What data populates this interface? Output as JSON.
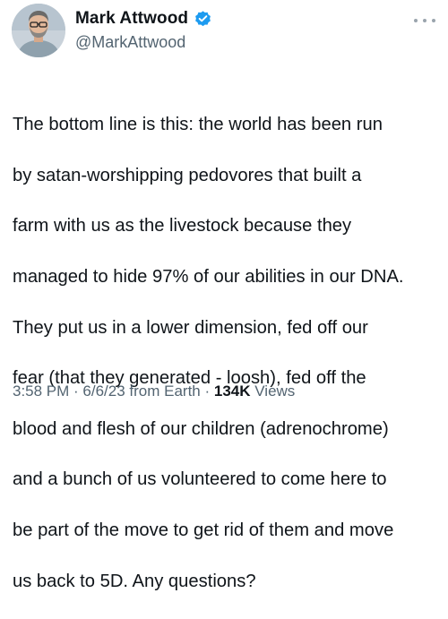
{
  "author": {
    "display_name": "Mark Attwood",
    "handle": "@MarkAttwood",
    "verified": true,
    "verified_color": "#1d9bf0",
    "avatar_icon": "user-avatar"
  },
  "tweet": {
    "lines": [
      "The bottom line is this: the world has been run",
      "by satan-worshipping pedovores that built a",
      "farm with us as the livestock because they",
      "managed to hide 97% of our abilities in our DNA.",
      "They put us in a lower dimension, fed off our",
      "fear (that they generated - loosh), fed off the",
      "blood and flesh of our children (adrenochrome)",
      "and a bunch of us volunteered to come here to",
      "be part of the move to get rid of them and move",
      "us back to 5D. Any questions?"
    ]
  },
  "meta": {
    "time": "3:58 PM",
    "sep1": " · ",
    "date": "6/6/23",
    "source": " from Earth",
    "sep2": " · ",
    "views_count": "134K",
    "views_label": " Views"
  },
  "more_icon": "more-dots-icon"
}
